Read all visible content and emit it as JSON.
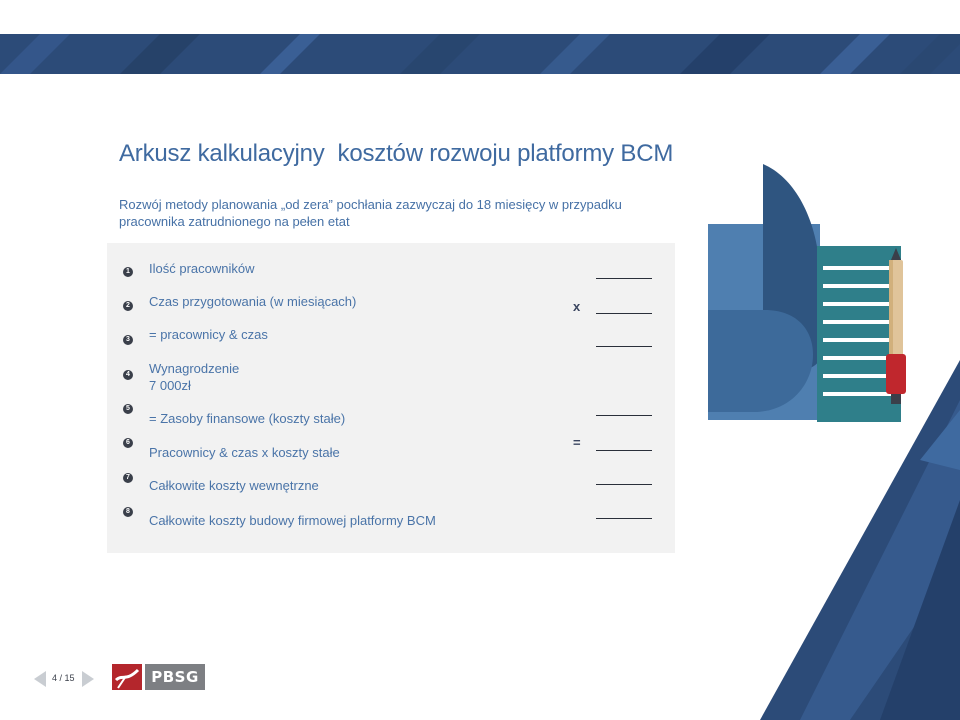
{
  "slide": {
    "title": "Arkusz kalkulacyjny  kosztów rozwoju platformy BCM",
    "subtitle": "Rozwój metody planowania „od zera” pochłania zazwyczaj do 18 miesięcy w przypadku pracownika zatrudnionego na pełen etat"
  },
  "calculation": {
    "rows": [
      {
        "number": "1",
        "label": "Ilość pracowników"
      },
      {
        "number": "2",
        "label": "Czas przygotowania (w miesiącach)",
        "operator": "x"
      },
      {
        "number": "3",
        "label": "= pracownicy & czas"
      },
      {
        "number": "4",
        "label": "Wynagrodzenie",
        "label_line2": "7 000zł"
      },
      {
        "number": "5",
        "label": "= Zasoby finansowe (koszty stałe)"
      },
      {
        "number": "6",
        "label": "Pracownicy & czas x koszty stałe",
        "operator": "="
      },
      {
        "number": "7",
        "label": "Całkowite koszty wewnętrzne"
      },
      {
        "number": "8",
        "label": "Całkowite koszty budowy  firmowej platformy BCM"
      }
    ]
  },
  "pager": {
    "current_of_total": "4 / 15"
  },
  "logo": {
    "text": "PBSG"
  },
  "icons": {
    "prev": "triangle-left-icon",
    "next": "triangle-right-icon",
    "illustration": "document-pen-illustration"
  },
  "colors": {
    "title": "#3f6aa0",
    "banner": "#2c4b78",
    "panel": "#f2f2f2",
    "logo_red": "#b4262c",
    "logo_gray": "#7d7f83",
    "illustration_dark": "#2f5580",
    "illustration_light": "#4f7fb0",
    "illustration_teal": "#2f7f8a"
  }
}
